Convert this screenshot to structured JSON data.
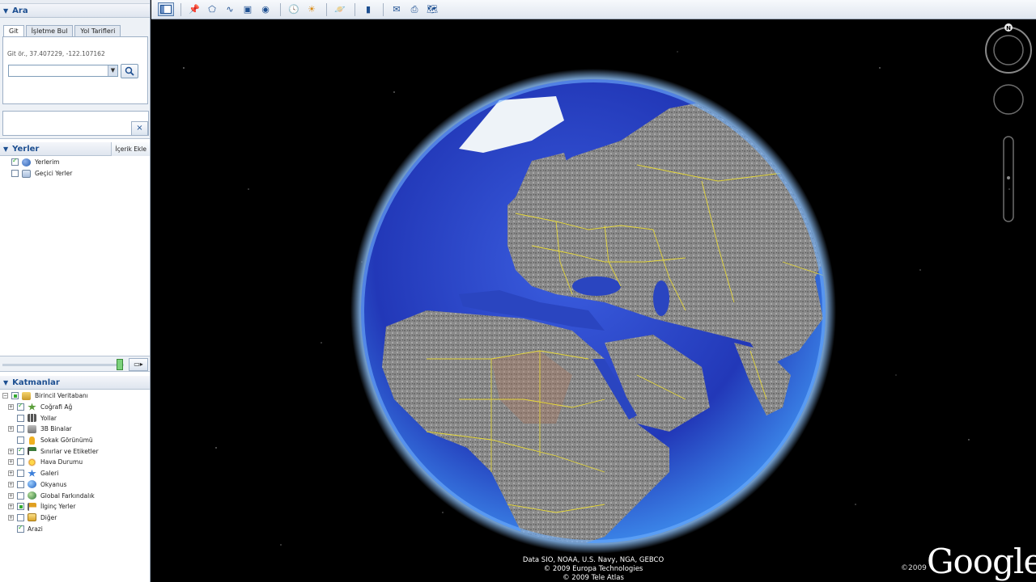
{
  "search": {
    "header": "Ara",
    "tabs": [
      "Git",
      "İşletme Bul",
      "Yol Tarifleri"
    ],
    "hint": "Git ör., 37.407229, -122.107162",
    "input_value": "",
    "close_label": "×"
  },
  "places": {
    "header": "Yerler",
    "content_add": "İçerik Ekle",
    "items": [
      {
        "label": "Yerlerim",
        "checked": true
      },
      {
        "label": "Geçici Yerler",
        "checked": false
      }
    ]
  },
  "layers": {
    "header": "Katmanlar",
    "items": [
      {
        "label": "Birincil Veritabanı",
        "icon": "globe-folder-icon"
      },
      {
        "label": "Coğrafi Ağ",
        "icon": "star-icon"
      },
      {
        "label": "Yollar",
        "icon": "road-icon"
      },
      {
        "label": "3B Binalar",
        "icon": "building-icon"
      },
      {
        "label": "Sokak Görünümü",
        "icon": "pegman-icon"
      },
      {
        "label": "Sınırlar ve Etiketler",
        "icon": "flag-icon"
      },
      {
        "label": "Hava Durumu",
        "icon": "sun-icon"
      },
      {
        "label": "Galeri",
        "icon": "star-icon"
      },
      {
        "label": "Okyanus",
        "icon": "ocean-icon"
      },
      {
        "label": "Global Farkındalık",
        "icon": "globe-icon"
      },
      {
        "label": "İlginç Yerler",
        "icon": "pin-icon"
      },
      {
        "label": "Diğer",
        "icon": "folder-icon"
      },
      {
        "label": "Arazi",
        "icon": ""
      }
    ]
  },
  "map": {
    "attribution": [
      "Data SIO, NOAA, U.S. Navy, NGA, GEBCO",
      "© 2009 Europa Technologies",
      "© 2009 Tele Atlas"
    ],
    "copyright": "©2009",
    "logo": "Google",
    "compass_north": "N"
  },
  "colors": {
    "panel_header_text": "#1d4f91",
    "ocean": "#2b46c8",
    "land": "#8a8a8a",
    "borders": "#f0e030"
  }
}
